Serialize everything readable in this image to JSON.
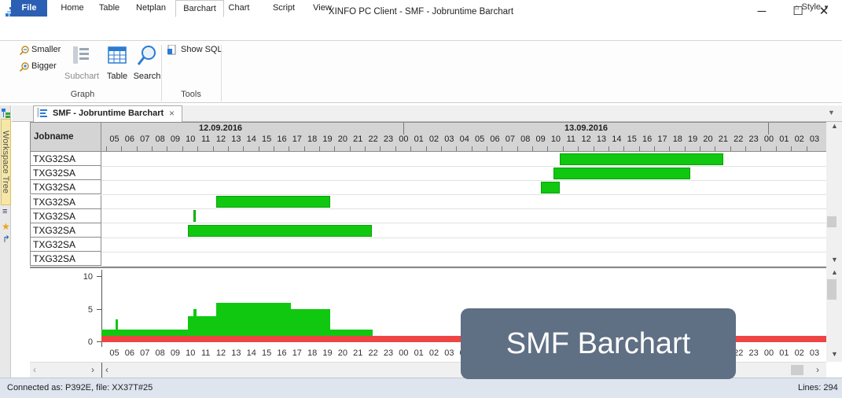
{
  "window": {
    "title": "XINFO PC Client - SMF - Jobruntime Barchart",
    "minimize_glyph": "─",
    "maximize_glyph": "☐",
    "close_glyph": "✕"
  },
  "ribbon_tabs": [
    "File",
    "Home",
    "Table",
    "Netplan",
    "Barchart",
    "Chart",
    "Script",
    "View"
  ],
  "active_tab": "Barchart",
  "style_label": "Style",
  "ribbon": {
    "smaller": "Smaller",
    "bigger": "Bigger",
    "subchart": "Subchart",
    "table": "Table",
    "search": "Search",
    "show_sql": "Show SQL",
    "group_graph": "Graph",
    "group_tools": "Tools"
  },
  "side_panel": {
    "workspace_tree": "Workspace Tree"
  },
  "document_tab": {
    "title": "SMF - Jobruntime Barchart",
    "close_glyph": "×"
  },
  "grid": {
    "column_header": "Jobname",
    "dates": [
      "12.09.2016",
      "13.09.2016"
    ],
    "hours": [
      "05",
      "06",
      "07",
      "08",
      "09",
      "10",
      "11",
      "12",
      "13",
      "14",
      "15",
      "16",
      "17",
      "18",
      "19",
      "20",
      "21",
      "22",
      "23",
      "00",
      "01",
      "02",
      "03",
      "04",
      "05",
      "06",
      "07",
      "08",
      "09",
      "10",
      "11",
      "12",
      "13",
      "14",
      "15",
      "16",
      "17",
      "18",
      "19",
      "20",
      "21",
      "22",
      "23",
      "00",
      "01",
      "02",
      "03",
      "04"
    ],
    "rows": [
      "TXG32SA",
      "TXG32SA",
      "TXG32SA",
      "TXG32SA",
      "TXG32SA",
      "TXG32SA",
      "TXG32SA",
      "TXG32SA"
    ]
  },
  "histogram": {
    "y_ticks": [
      "10",
      "5",
      "0"
    ]
  },
  "status": {
    "connection": "Connected as: P392E, file: XX37T#25",
    "lines": "Lines: 294"
  },
  "overlay": {
    "caption": "SMF Barchart"
  },
  "colors": {
    "accent": "#2b5fb3",
    "bar_green": "#10c810",
    "baseline_red": "#ee4444",
    "overlay": "#5f6f84"
  }
}
